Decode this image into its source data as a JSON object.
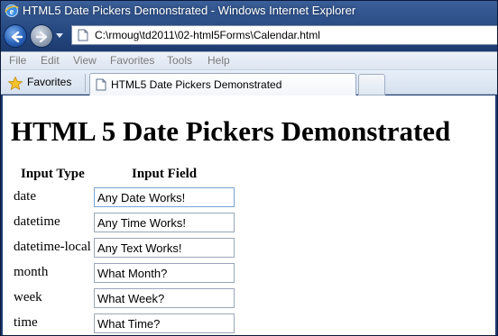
{
  "window": {
    "title": "HTML5 Date Pickers Demonstrated - Windows Internet Explorer"
  },
  "address": {
    "url": "C:\\rmoug\\td2011\\02-html5Forms\\Calendar.html"
  },
  "menu": {
    "items": [
      "File",
      "Edit",
      "View",
      "Favorites",
      "Tools",
      "Help"
    ]
  },
  "favorites": {
    "label": "Favorites"
  },
  "tab": {
    "label": "HTML5 Date Pickers Demonstrated"
  },
  "page": {
    "heading": "HTML 5 Date Pickers Demonstrated",
    "table": {
      "headers": [
        "Input Type",
        "Input Field"
      ],
      "rows": [
        {
          "type": "date",
          "value": "Any Date Works!"
        },
        {
          "type": "datetime",
          "value": "Any Time Works!"
        },
        {
          "type": "datetime-local",
          "value": "Any Text Works!"
        },
        {
          "type": "month",
          "value": "What Month?"
        },
        {
          "type": "week",
          "value": "What Week?"
        },
        {
          "type": "time",
          "value": "What Time?"
        }
      ]
    }
  },
  "colors": {
    "titlebar": "#23447c",
    "content_bg": "#ffffff",
    "focused_field_border": "#7aa3d4"
  },
  "icons": [
    "ie-icon",
    "back-arrow-icon",
    "forward-arrow-icon",
    "page-icon",
    "star-icon",
    "tab-page-icon"
  ]
}
